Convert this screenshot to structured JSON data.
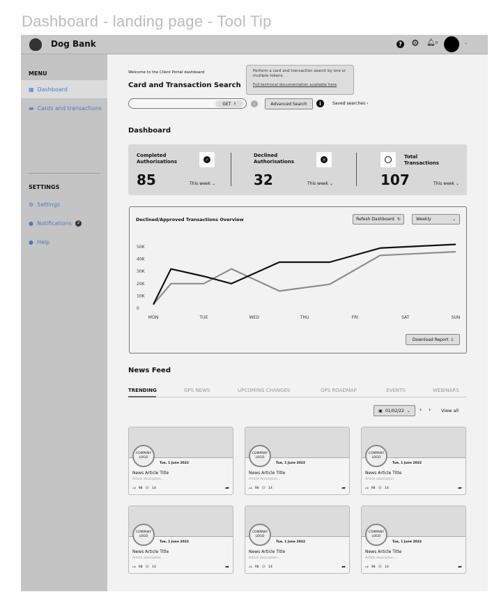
{
  "page_title": "Dashboard - landing page - Tool Tip",
  "header": {
    "brand": "Dog Bank",
    "icons": [
      "help-icon",
      "gear-icon",
      "bell-icon",
      "avatar",
      "chevron-down-icon"
    ],
    "notification_count": "0"
  },
  "sidebar": {
    "menu_heading": "MENU",
    "menu_items": [
      {
        "label": "Dashboard",
        "icon": "grid-icon",
        "active": true
      },
      {
        "label": "Cards and transactions",
        "icon": "card-icon"
      }
    ],
    "settings_heading": "SETTINGS",
    "settings_items": [
      {
        "label": "Settings",
        "icon": "gear-icon"
      },
      {
        "label": "Notifications",
        "icon": "bell-icon",
        "badge": "2"
      },
      {
        "label": "Help",
        "icon": "help-icon"
      }
    ]
  },
  "search": {
    "welcome": "Welcome to the Client Portal dashboard",
    "title": "Card and Transaction Search",
    "get_label": "GET",
    "advanced_label": "Advanced Search",
    "saved_label": "Saved searches",
    "tooltip_line1": "Perform a card and transaction search by one or multiple tokens.",
    "tooltip_link": "Full technical documentation available here"
  },
  "dashboard": {
    "title": "Dashboard",
    "stats": [
      {
        "label": "Completed Authorisations",
        "value": "85",
        "period": "This week",
        "icon": "check-circle-icon"
      },
      {
        "label": "Declined Authorisations",
        "value": "32",
        "period": "This week",
        "icon": "x-circle-icon"
      },
      {
        "label": "Total Transactions",
        "value": "107",
        "period": "This week",
        "icon": "circle-icon"
      }
    ]
  },
  "chart_panel": {
    "refresh_label": "Refesh Dashboard",
    "period_select": "Weekly",
    "download_label": "Download Report"
  },
  "chart_data": {
    "type": "line",
    "title": "Declined/Approved Transactions Overview",
    "categories": [
      "MON",
      "TUE",
      "WED",
      "THU",
      "FRI",
      "SAT",
      "SUN"
    ],
    "yticks": [
      "0",
      "10K",
      "20K",
      "30K",
      "40K",
      "50K"
    ],
    "ylim": [
      0,
      50000
    ],
    "grid": false,
    "series": [
      {
        "color": "#111111",
        "points": [
          [
            0,
            3000
          ],
          [
            0.35,
            32000
          ],
          [
            1,
            26000
          ],
          [
            1.55,
            20000
          ],
          [
            2.5,
            37500
          ],
          [
            3.5,
            37500
          ],
          [
            4.5,
            49000
          ],
          [
            6,
            52000
          ]
        ]
      },
      {
        "color": "#8c8c8c",
        "points": [
          [
            0,
            3000
          ],
          [
            0.35,
            20000
          ],
          [
            1,
            20000
          ],
          [
            1.55,
            32000
          ],
          [
            2.5,
            14000
          ],
          [
            3.5,
            19500
          ],
          [
            4.5,
            43000
          ],
          [
            6,
            46000
          ]
        ]
      }
    ]
  },
  "news": {
    "title": "News Feed",
    "tabs": [
      "TRENDING",
      "GPS NEWS",
      "UPCOMING CHANGES",
      "GPS ROADMAP",
      "EVENTS",
      "WEBINARS"
    ],
    "active_tab": "TRENDING",
    "date": "01/02/22",
    "view_all": "View all",
    "articles": [
      {
        "logo": "COMPANY LOGO",
        "date": "Tue, 1 June 2022",
        "title": "News Article Title",
        "desc": "Article description...",
        "likes": "98",
        "comments": "14"
      },
      {
        "logo": "COMPANY LOGO",
        "date": "Tue, 1 June 2022",
        "title": "News Article Title",
        "desc": "Article description...",
        "likes": "98",
        "comments": "14"
      },
      {
        "logo": "COMPANY LOGO",
        "date": "Tue, 1 June 2022",
        "title": "News Article Title",
        "desc": "Article description...",
        "likes": "98",
        "comments": "14"
      },
      {
        "logo": "COMPANY LOGO",
        "date": "Tue, 1 June 2022",
        "title": "News Article Title",
        "desc": "Article description...",
        "likes": "98",
        "comments": "14"
      },
      {
        "logo": "COMPANY LOGO",
        "date": "Tue, 1 June 2022",
        "title": "News Article Title",
        "desc": "Article description...",
        "likes": "98",
        "comments": "14"
      },
      {
        "logo": "COMPANY LOGO",
        "date": "Tue, 1 June 2022",
        "title": "News Article Title",
        "desc": "Article description...",
        "likes": "98",
        "comments": "14"
      }
    ]
  }
}
